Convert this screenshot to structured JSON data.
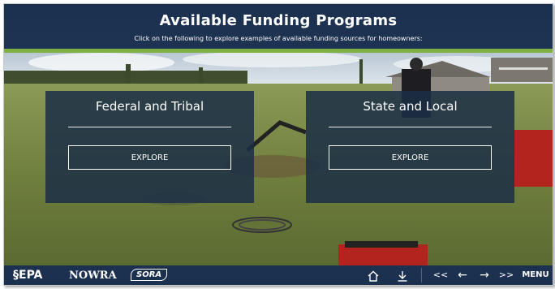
{
  "header": {
    "title": "Available Funding Programs",
    "subtitle": "Click on the following to explore examples of available funding sources for homeowners:"
  },
  "cards": [
    {
      "title": "Federal and Tribal",
      "button_label": "EXPLORE"
    },
    {
      "title": "State and Local",
      "button_label": "EXPLORE"
    }
  ],
  "footer": {
    "logos": [
      "§EPA",
      "NOWRA",
      "SORA"
    ],
    "home_icon": "home-icon",
    "download_icon": "download-icon",
    "nav": {
      "first": "<<",
      "prev": "←",
      "next": "→",
      "last": ">>",
      "menu": "MENU"
    }
  },
  "colors": {
    "header_bg": "#1c3050",
    "accent_bar": "#7fb042",
    "card_bg": "#1c2e46"
  }
}
